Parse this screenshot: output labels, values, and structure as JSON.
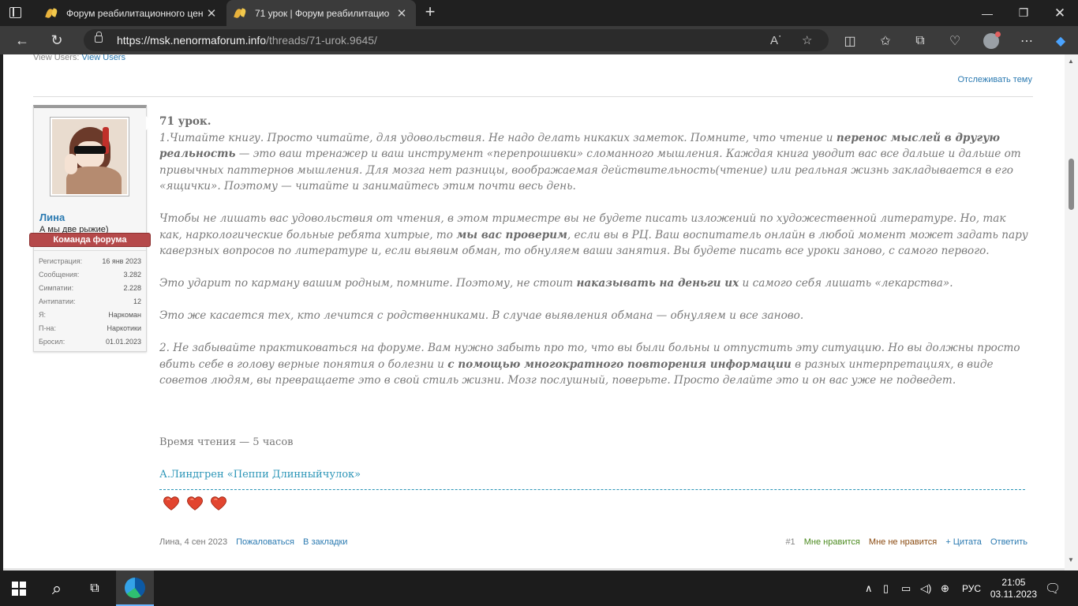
{
  "browser": {
    "tabs": [
      {
        "title": "Форум реабилитационного цен"
      },
      {
        "title": "71 урок | Форум реабилитацио"
      }
    ],
    "url_host": "https://msk.nenormaforum.info",
    "url_path": "/threads/71-urok.9645/"
  },
  "page": {
    "view_users_label": "View Users:",
    "view_users_link": "View Users",
    "watch_thread": "Отслеживать тему"
  },
  "user": {
    "name": "Лина",
    "title": "А мы две рыжие)",
    "banner": "Команда форума",
    "stats": [
      {
        "k": "Регистрация:",
        "v": "16 янв 2023"
      },
      {
        "k": "Сообщения:",
        "v": "3.282"
      },
      {
        "k": "Симпатии:",
        "v": "2.228"
      },
      {
        "k": "Антипатии:",
        "v": "12"
      },
      {
        "k": "Я:",
        "v": "Наркоман"
      },
      {
        "k": "П-на:",
        "v": "Наркотики"
      },
      {
        "k": "Бросил:",
        "v": "01.01.2023"
      }
    ]
  },
  "post": {
    "heading": "71 урок.",
    "p1_a": "1.Читайте книгу. Просто читайте, для удовольствия. Не надо делать никаких заметок. Помните, что чтение и ",
    "p1_b": "перенос мыслей в другую реальность",
    "p1_c": " — это ваш тренажер и ваш инструмент «перепрошивки» сломанного мышления. Каждая книга уводит вас все дальше и дальше от привычных паттернов мышления. Для мозга нет разницы, воображаемая действительность(чтение) или реальная жизнь закладывается в его «ящички». Поэтому — читайте и занимайтесь этим почти весь день.",
    "p2_a": "Чтобы не лишать вас удовольствия от чтения, в этом триместре вы не будете писать изложений по художественной литературе. Но, так как, наркологические больные ребята хитрые, то ",
    "p2_b": "мы вас проверим",
    "p2_c": ", если вы в РЦ. Ваш воспитатель онлайн в любой момент может задать пару каверзных вопросов по литературе и, если выявим обман, то обнуляем ваши занятия. Вы будете писать все уроки заново, с самого первого.",
    "p3_a": "Это ударит по карману вашим родным, помните. Поэтому, не стоит ",
    "p3_b": "наказывать на деньги их",
    "p3_c": " и самого себя лишать «лекарства».",
    "p4": "Это же касается тех, кто лечится с родственниками. В случае выявления обмана — обнуляем и все заново.",
    "p5_a": "2. Не забывайте практиковаться на форуме. Вам нужно забыть про то, что вы были больны и отпустить эту ситуацию. Но вы должны просто вбить себе в голову верные понятия о болезни и ",
    "p5_b": "с помощью многократного повторения информации",
    "p5_c": " в разных интерпретациях, в виде советов людям, вы превращаете это в свой стиль жизни. Мозг послушный, поверьте. Просто делайте это и он вас уже не подведет.",
    "read_time": "Время чтения — 5 часов",
    "book": "А.Линдгрен «Пеппи Длинныйчулок»",
    "hearts_count": 3
  },
  "footer": {
    "meta": "Лина, 4 сен 2023",
    "report": "Пожаловаться",
    "bookmark": "В закладки",
    "num": "#1",
    "like": "Мне нравится",
    "dislike": "Мне не нравится",
    "quote": "+ Цитата",
    "reply": "Ответить"
  },
  "taskbar": {
    "lang": "РУС",
    "time": "21:05",
    "date": "03.11.2023"
  },
  "colors": {
    "accent": "#2b7ab1",
    "banner": "#b5494a",
    "link_cyan": "#2b95b7"
  }
}
